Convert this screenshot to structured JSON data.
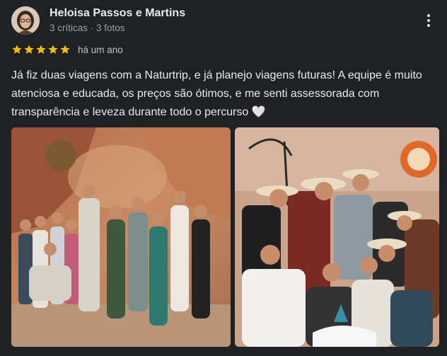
{
  "reviewer": {
    "name": "Heloisa Passos e Martins",
    "stats": "3 críticas · 3 fotos"
  },
  "review": {
    "rating": 5,
    "date": "há um ano",
    "text": "Já fiz duas viagens com a Naturtrip, e já planejo viagens futuras! A equipe é muito atenciosa e educada, os preços são ótimos, e me senti assessorada com transparência e leveza durante todo o percurso 🤍"
  },
  "photos": [
    {
      "icon": "group-photo-canyon"
    },
    {
      "icon": "group-photo-hats"
    }
  ],
  "icons": {
    "more": "more-vert-icon",
    "star": "star-icon"
  },
  "colors": {
    "background": "#202124",
    "star": "#fbbc04",
    "text": "#e8eaed",
    "secondary": "#9aa0a6"
  }
}
